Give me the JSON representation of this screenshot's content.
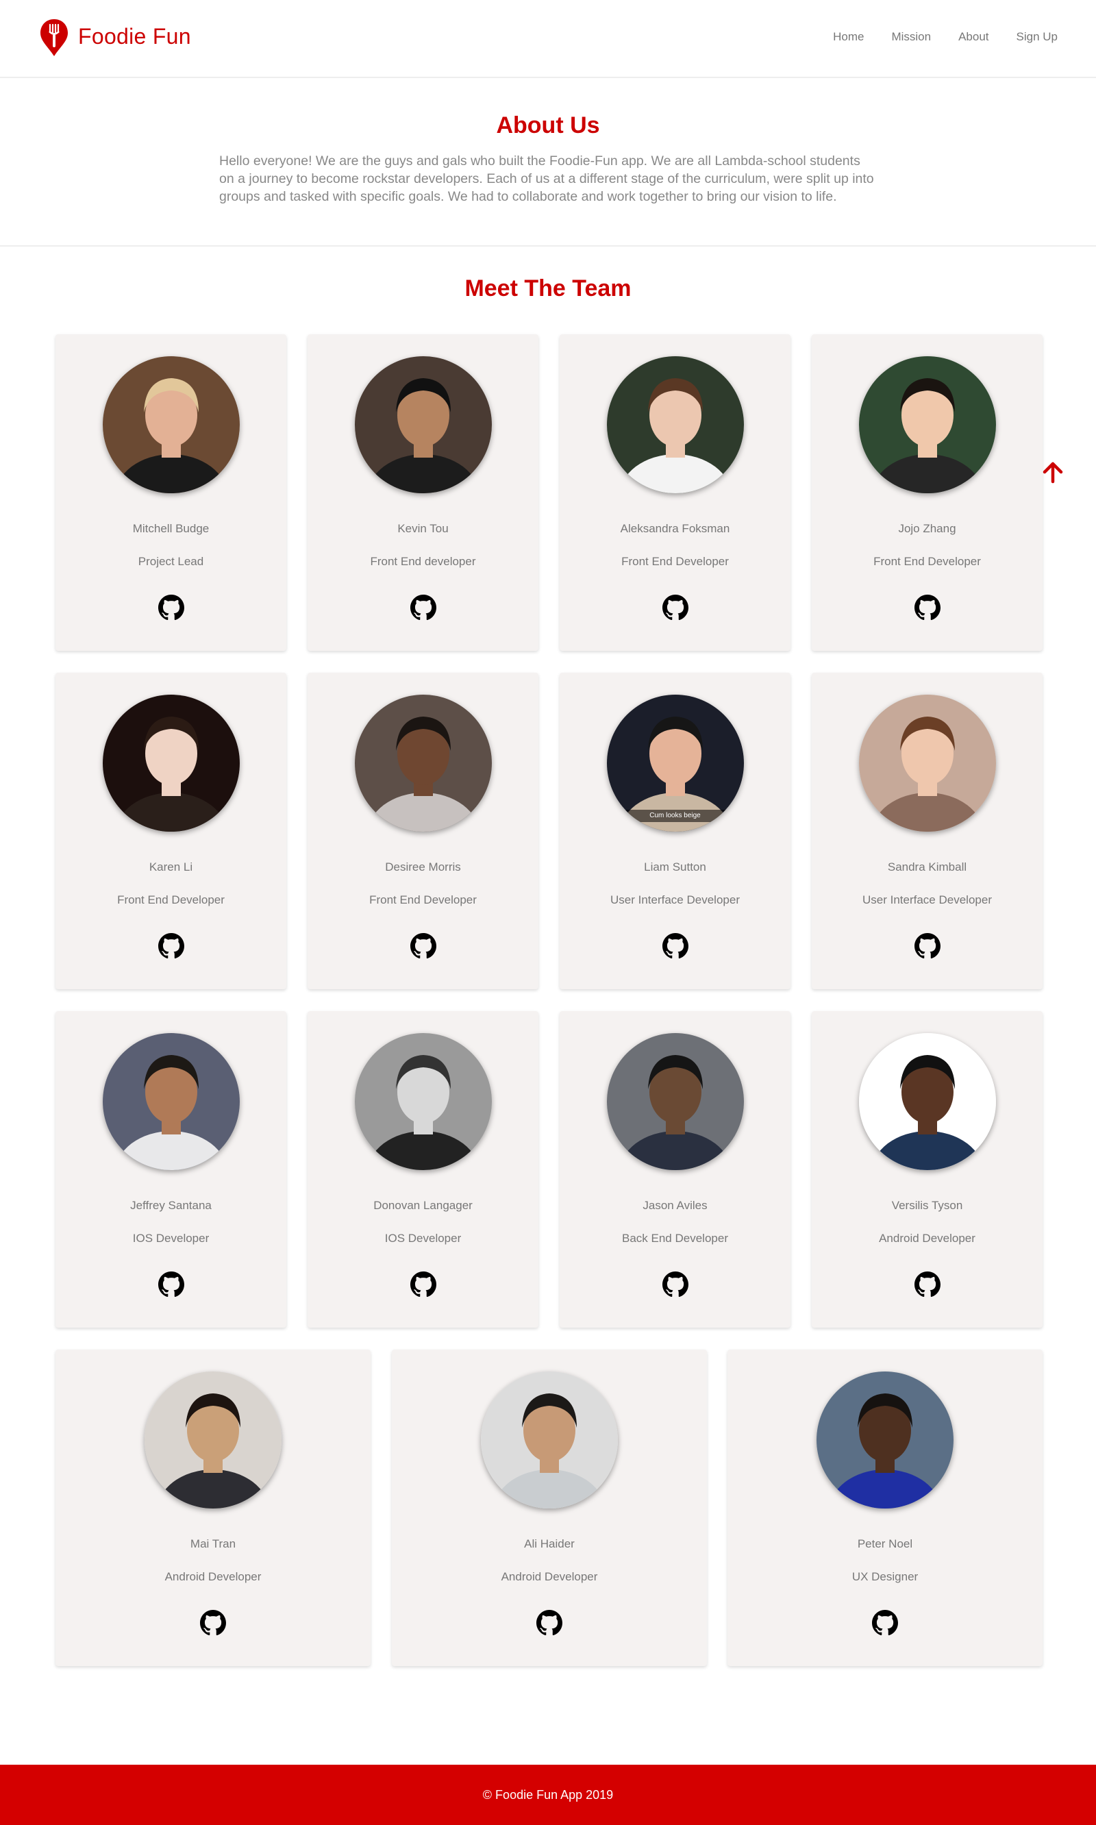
{
  "brand": {
    "name": "Foodie Fun",
    "icon": "fork-pin-icon",
    "color": "#cc0000"
  },
  "nav": {
    "items": [
      "Home",
      "Mission",
      "About",
      "Sign Up"
    ]
  },
  "about": {
    "title": "About Us",
    "text": "Hello everyone! We are the guys and gals who built the Foodie-Fun app. We are all Lambda-school students on a journey to become rockstar developers. Each of us at a different stage of the curriculum, were split up into groups and tasked with specific goals. We had to collaborate and work together to bring our vision to life."
  },
  "team": {
    "title": "Meet The Team",
    "members": [
      {
        "name": "Mitchell Budge",
        "role": "Project Lead",
        "icon": "github-icon"
      },
      {
        "name": "Kevin Tou",
        "role": "Front End developer",
        "icon": "github-icon"
      },
      {
        "name": "Aleksandra Foksman",
        "role": "Front End Developer",
        "icon": "github-icon"
      },
      {
        "name": "Jojo Zhang",
        "role": "Front End Developer",
        "icon": "github-icon"
      },
      {
        "name": "Karen Li",
        "role": "Front End Developer",
        "icon": "github-icon"
      },
      {
        "name": "Desiree Morris",
        "role": "Front End Developer",
        "icon": "github-icon"
      },
      {
        "name": "Liam Sutton",
        "role": "User Interface Developer",
        "icon": "github-icon"
      },
      {
        "name": "Sandra Kimball",
        "role": "User Interface Developer",
        "icon": "github-icon"
      },
      {
        "name": "Jeffrey Santana",
        "role": "IOS Developer",
        "icon": "github-icon"
      },
      {
        "name": "Donovan Langager",
        "role": "IOS Developer",
        "icon": "github-icon"
      },
      {
        "name": "Jason Aviles",
        "role": "Back End Developer",
        "icon": "github-icon"
      },
      {
        "name": "Versilis Tyson",
        "role": "Android Developer",
        "icon": "github-icon"
      },
      {
        "name": "Mai Tran",
        "role": "Android Developer",
        "icon": "github-icon"
      },
      {
        "name": "Ali Haider",
        "role": "Android Developer",
        "icon": "github-icon"
      },
      {
        "name": "Peter Noel",
        "role": "UX Designer",
        "icon": "github-icon"
      }
    ]
  },
  "photo_caption": "Cum looks beige",
  "scroll_top": {
    "icon": "arrow-up-icon"
  },
  "footer": {
    "text": "© Foodie Fun App 2019",
    "color": "#d40000"
  }
}
